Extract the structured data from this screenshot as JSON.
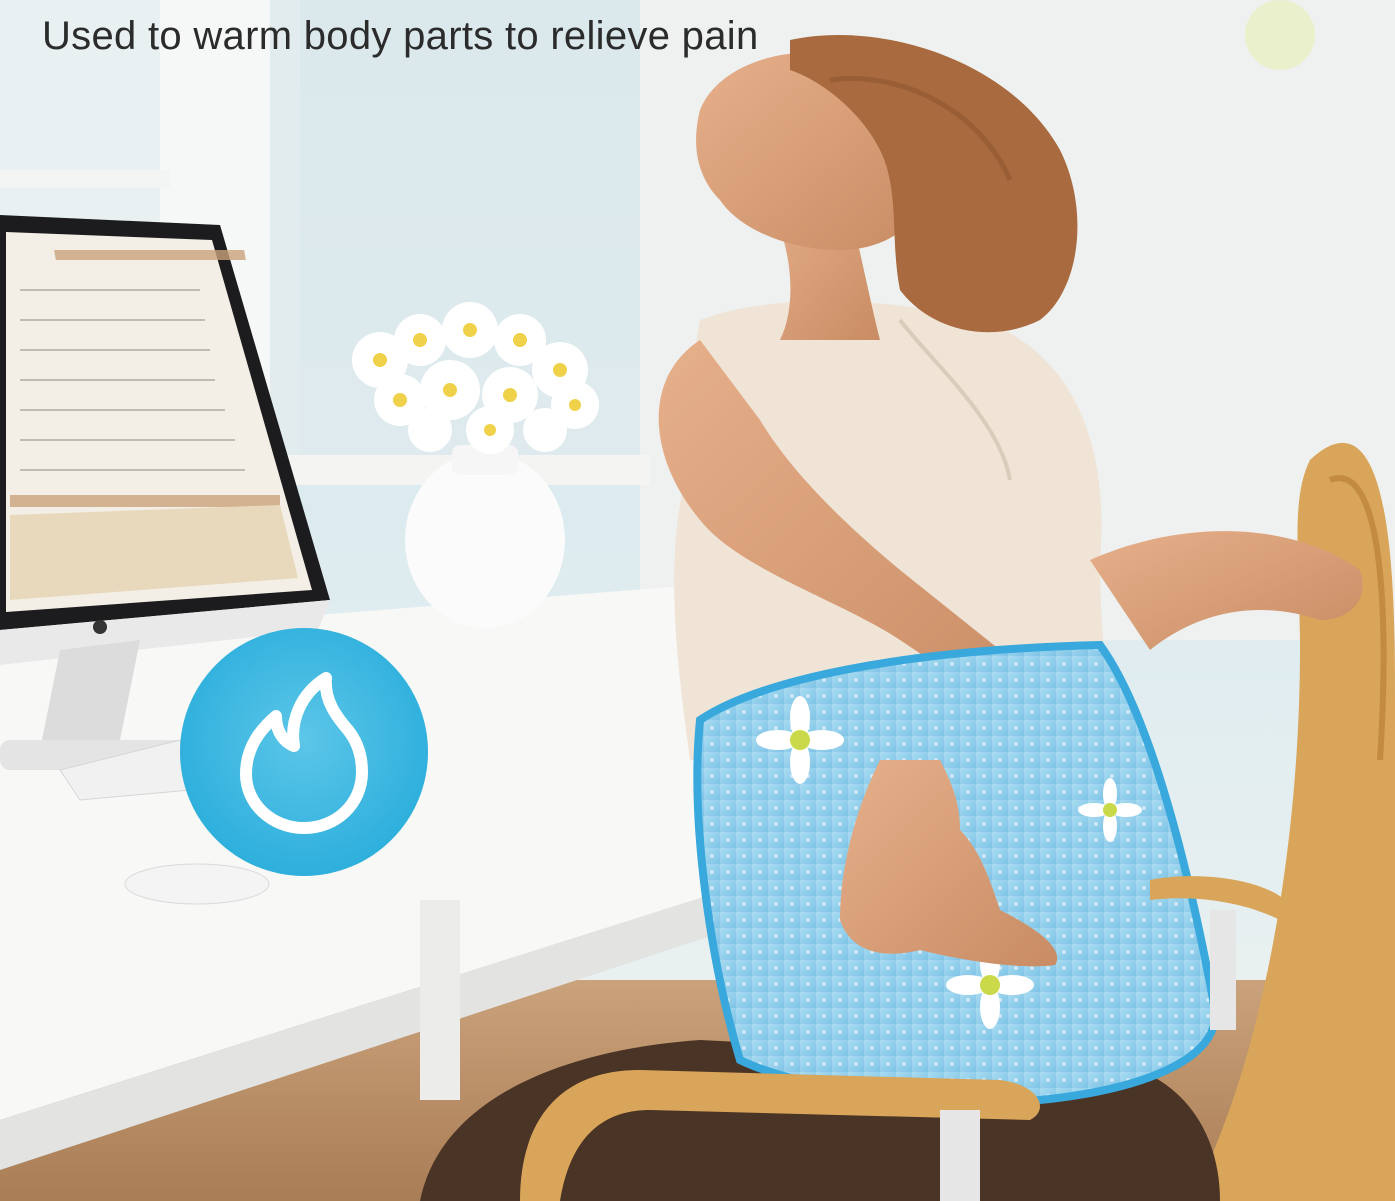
{
  "headline": "Used to warm body parts to relieve pain",
  "badge": {
    "icon": "flame-icon",
    "color": "#2fb0dd"
  },
  "colors": {
    "wall": "#dfe9ee",
    "desk": "#f7f7f5",
    "heating_pad": "#8ecbe8",
    "chair": "#d9a55a",
    "blouse": "#efe4d6",
    "pants": "#4a3426"
  }
}
